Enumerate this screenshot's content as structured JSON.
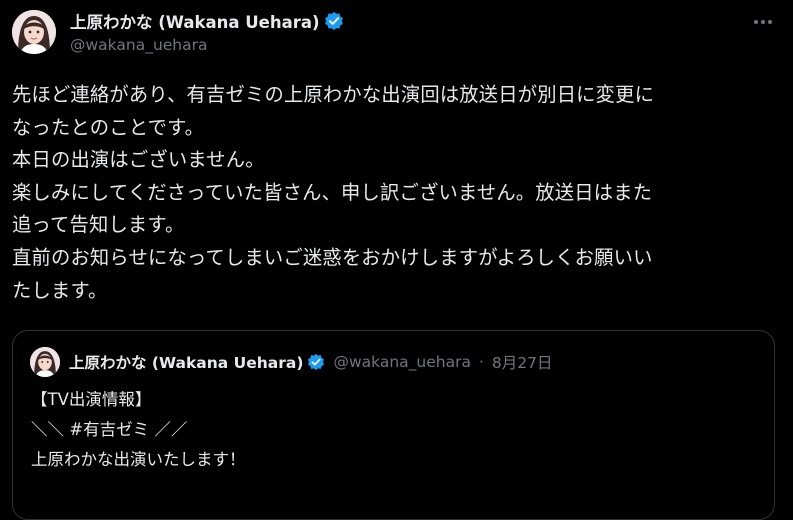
{
  "author": {
    "display_name": "上原わかな (Wakana Uehara)",
    "handle": "@wakana_uehara",
    "verified_icon": "verified-badge-icon"
  },
  "tweet": {
    "lines": [
      "先ほど連絡があり、有吉ゼミの上原わかな出演回は放送日が別日に変更に",
      "なったとのことです。",
      "本日の出演はございません。",
      "楽しみにしてくださっていた皆さん、申し訳ございません。放送日はまた",
      "追って告知します。",
      "直前のお知らせになってしまいご迷惑をおかけしますがよろしくお願いい",
      "たします。"
    ]
  },
  "quoted_tweet": {
    "display_name": "上原わかな (Wakana Uehara)",
    "handle": "@wakana_uehara",
    "separator": "·",
    "date": "8月27日",
    "lines": [
      "【TV出演情報】",
      "＼＼ #有吉ゼミ ／／",
      "上原わかな出演いたします！"
    ]
  },
  "colors": {
    "background": "#000000",
    "text": "#e7e9ea",
    "muted": "#71767b",
    "verified": "#1d9bf0",
    "border": "#2f3336"
  }
}
